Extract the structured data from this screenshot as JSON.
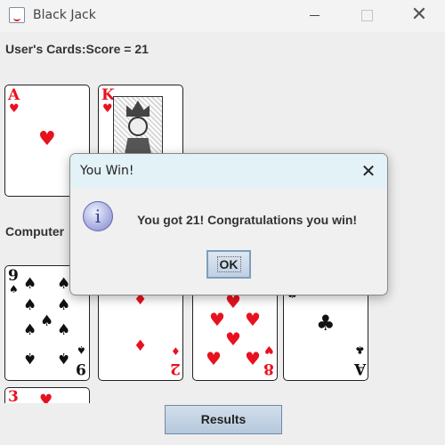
{
  "window": {
    "title": "Black Jack",
    "minimize_label": "",
    "maximize_label": "",
    "close_label": "✕"
  },
  "user_section": {
    "label": "User's Cards:Score = 21",
    "cards": [
      {
        "rank": "A",
        "suit": "♥",
        "color": "#e8121f",
        "center": "♥"
      },
      {
        "rank": "K",
        "suit": "♥",
        "color": "#e8121f",
        "center": ""
      }
    ]
  },
  "computer_section": {
    "label": "Computer",
    "cards": [
      {
        "rank": "9",
        "suit": "♠",
        "color": "#111111"
      },
      {
        "rank": "2",
        "suit": "♦",
        "color": "#e8121f"
      },
      {
        "rank": "8",
        "suit": "♥",
        "color": "#e8121f"
      },
      {
        "rank": "A",
        "suit": "♣",
        "color": "#111111"
      },
      {
        "rank": "3",
        "suit": "♥",
        "color": "#e8121f"
      }
    ]
  },
  "dialog": {
    "title": "You Win!",
    "close_label": "✕",
    "icon": "info-icon",
    "icon_glyph": "i",
    "message": "You got 21! Congratulations you win!",
    "ok_label": "OK"
  },
  "results_button": {
    "label": "Results"
  }
}
